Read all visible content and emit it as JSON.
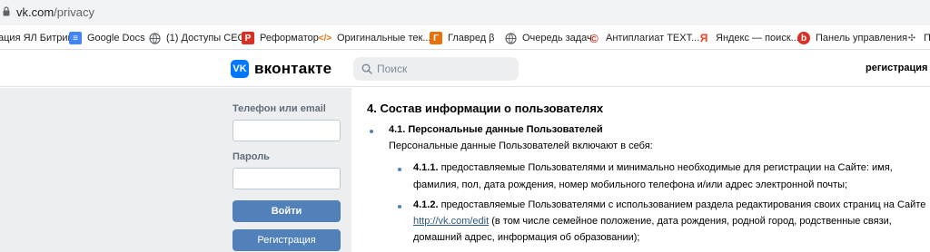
{
  "browser": {
    "url_host": "vk.com",
    "url_path": "/privacy",
    "bookmarks": [
      {
        "label": "ация ЯЛ Битрикс",
        "icon": "bitrix-icon",
        "color": "#2fc7f7"
      },
      {
        "label": "Google Docs",
        "icon": "docs-icon",
        "color": "#4285f4"
      },
      {
        "label": "(1) Доступы СЕО",
        "icon": "globe-icon",
        "color": "#5f6368"
      },
      {
        "label": "Реформатор",
        "icon": "reformator-icon",
        "color": "#d93025"
      },
      {
        "label": "Оригинальные тек...",
        "icon": "code-icon",
        "color": "#e8710a"
      },
      {
        "label": "Главред β",
        "icon": "glavred-icon",
        "color": "#e8710a"
      },
      {
        "label": "Очередь задач",
        "icon": "globe-icon",
        "color": "#5f6368"
      },
      {
        "label": "Антиплагиат TEXT...",
        "icon": "copyright-icon",
        "color": "#d93025"
      },
      {
        "label": "Яндекс — поиск...",
        "icon": "yandex-icon",
        "color": "#fc3f1d"
      },
      {
        "label": "Панель управления",
        "icon": "beget-icon",
        "color": "#d93025"
      },
      {
        "label": "П",
        "icon": "puzzle-icon",
        "color": "#5f6368"
      }
    ]
  },
  "header": {
    "logo_text": "вконтакте",
    "logo_mark": "VK",
    "search_placeholder": "Поиск",
    "register_link": "регистрация",
    "brand_color": "#0077ff"
  },
  "login": {
    "phone_label": "Телефон или email",
    "phone_value": "",
    "password_label": "Пароль",
    "password_value": "",
    "login_button": "Войти",
    "register_button": "Регистрация",
    "button_color": "#5181b8"
  },
  "content": {
    "section_title": "4. Состав информации о пользователях",
    "item_4_1": {
      "number": "4.1. Персональные данные Пользователей",
      "text": "Персональные данные Пользователей включают в себя:"
    },
    "item_4_1_1": {
      "number": "4.1.1.",
      "line1": " предоставляемые Пользователями и минимально необходимые для регистрации на Сайте: имя,",
      "line2": "фамилия, пол, дата рождения, номер мобильного телефона и/или адрес электронной почты;"
    },
    "item_4_1_2": {
      "number": "4.1.2.",
      "line1": " предоставляемые Пользователями с использованием раздела редактирования своих страниц на Сайте",
      "link": "http://vk.com/edit",
      "line2_rest": " (в том числе семейное положение, дата рождения, родной город, родственные связи,",
      "line3": "домашний адрес, информация об образовании);"
    }
  }
}
